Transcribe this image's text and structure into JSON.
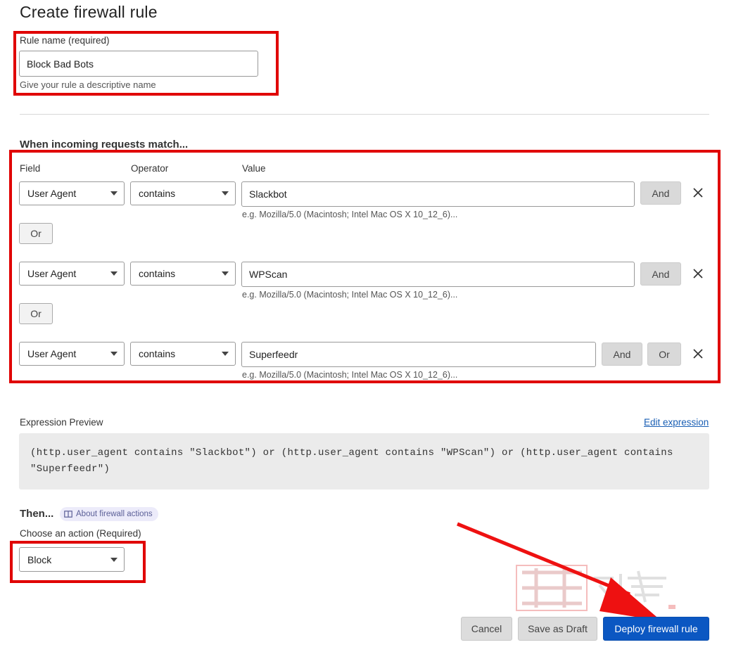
{
  "page": {
    "title": "Create firewall rule"
  },
  "rule_name": {
    "label": "Rule name (required)",
    "value": "Block Bad Bots",
    "hint": "Give your rule a descriptive name"
  },
  "match": {
    "heading": "When incoming requests match...",
    "columns": {
      "field": "Field",
      "operator": "Operator",
      "value": "Value"
    },
    "rows": [
      {
        "field": "User Agent",
        "operator": "contains",
        "value": "Slackbot",
        "hint": "e.g. Mozilla/5.0 (Macintosh; Intel Mac OS X 10_12_6)...",
        "and_label": "And"
      },
      {
        "field": "User Agent",
        "operator": "contains",
        "value": "WPScan",
        "hint": "e.g. Mozilla/5.0 (Macintosh; Intel Mac OS X 10_12_6)...",
        "and_label": "And"
      },
      {
        "field": "User Agent",
        "operator": "contains",
        "value": "Superfeedr",
        "hint": "e.g. Mozilla/5.0 (Macintosh; Intel Mac OS X 10_12_6)...",
        "and_label": "And",
        "or_label": "Or"
      }
    ],
    "or_connector": "Or"
  },
  "expression": {
    "label": "Expression Preview",
    "edit_link": "Edit expression",
    "line1": "(http.user_agent contains \"Slackbot\") or (http.user_agent contains \"WPScan\") or (http.user_agent contains",
    "line2": "\"Superfeedr\")"
  },
  "then": {
    "heading": "Then...",
    "about_link": "About firewall actions",
    "action_label": "Choose an action (Required)",
    "action_value": "Block"
  },
  "footer": {
    "cancel": "Cancel",
    "save_draft": "Save as Draft",
    "deploy": "Deploy firewall rule"
  },
  "colors": {
    "highlight": "#e00000",
    "primary": "#0b57c2"
  },
  "icons": {
    "remove": "close-icon",
    "dropdown": "caret-down-icon",
    "docs": "book-icon",
    "annotation": "red-arrow"
  }
}
